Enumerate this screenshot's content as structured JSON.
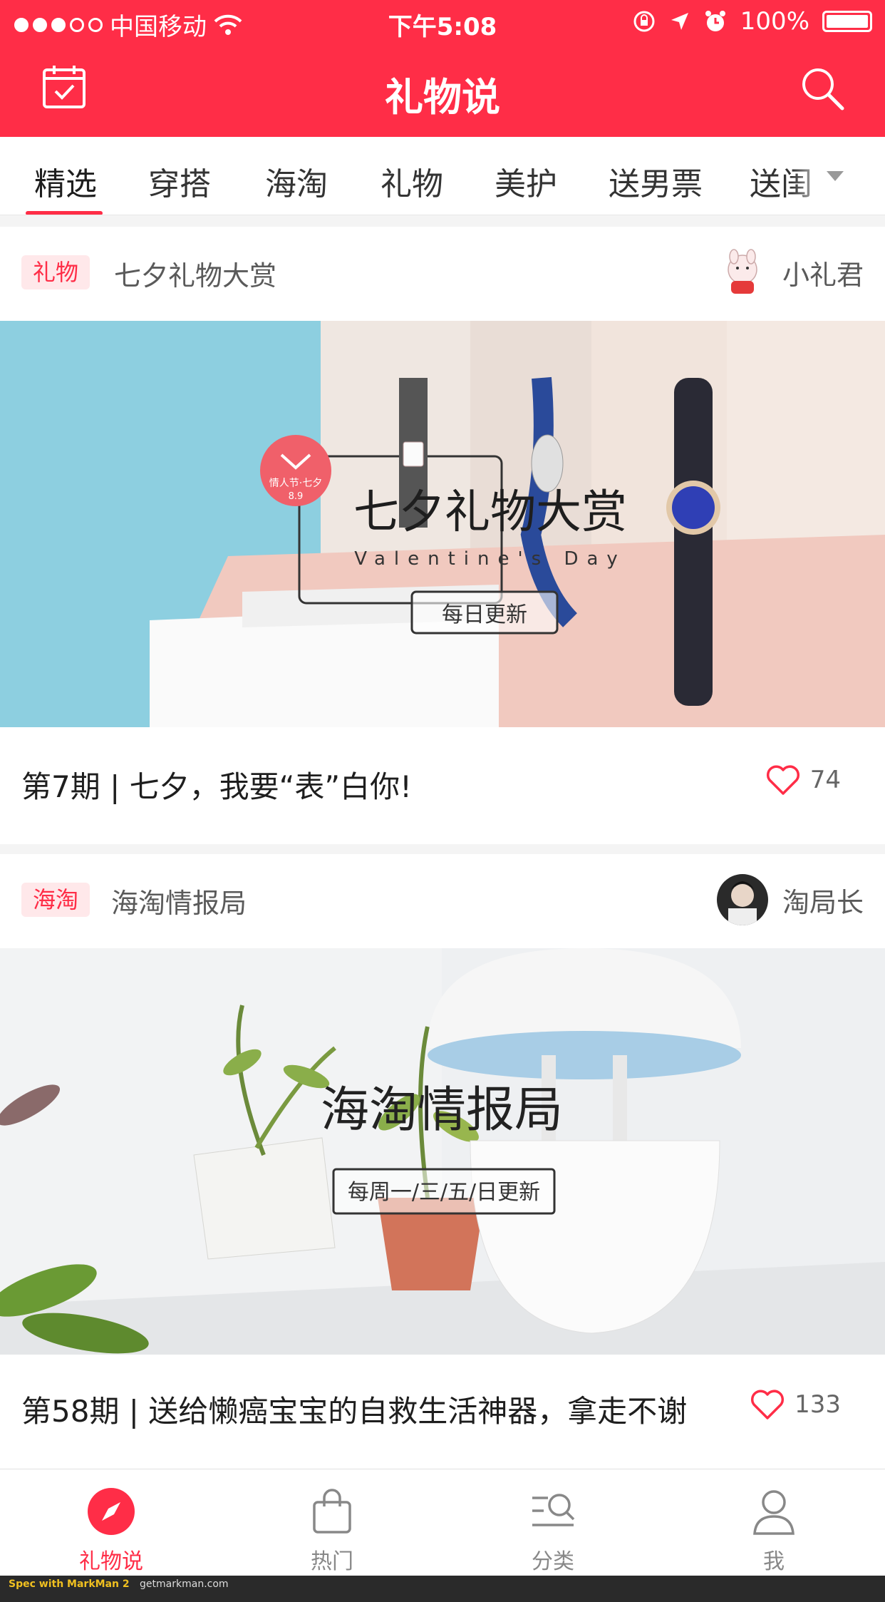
{
  "status_bar": {
    "carrier": "中国移动",
    "time": "下午5:08",
    "battery": "100%"
  },
  "nav": {
    "title": "礼物说",
    "left_icon": "calendar-check-icon",
    "right_icon": "search-icon"
  },
  "tabs": {
    "items": [
      "精选",
      "穿搭",
      "海淘",
      "礼物",
      "美护",
      "送男票",
      "送闺"
    ],
    "active": "精选"
  },
  "colors": {
    "brand": "#ff2d47",
    "tag_text": "#ff2d47",
    "tag_bg": "#fff0f0",
    "secondary_text": "#5a5a5a",
    "primary_text": "#1e1e1e"
  },
  "cards": [
    {
      "tag": "礼物",
      "column": "七夕礼物大赏",
      "author": "小礼君",
      "cover": {
        "title": "七夕礼物大赏",
        "subtitle": "Valentine's  Day",
        "badge": "每日更新",
        "seal_line1": "情人节·七夕",
        "seal_line2": "8.9"
      },
      "headline": "第7期 | 七夕，我要“表”白你!",
      "likes": "74"
    },
    {
      "tag": "海淘",
      "column": "海淘情报局",
      "author": "淘局长",
      "cover": {
        "title": "海淘情报局",
        "badge": "每周一/三/五/日更新"
      },
      "headline": "第58期 | 送给懒癌宝宝的自救生活神器，拿走不谢",
      "likes": "133"
    }
  ],
  "bottom_bar": {
    "items": [
      {
        "label": "礼物说",
        "icon": "compass-icon",
        "active": true
      },
      {
        "label": "热门",
        "icon": "shopping-bag-icon",
        "active": false
      },
      {
        "label": "分类",
        "icon": "category-search-icon",
        "active": false
      },
      {
        "label": "我",
        "icon": "person-icon",
        "active": false
      }
    ]
  },
  "watermark": {
    "text": "Spec with MarkMan 2",
    "site": "getmarkman.com"
  }
}
